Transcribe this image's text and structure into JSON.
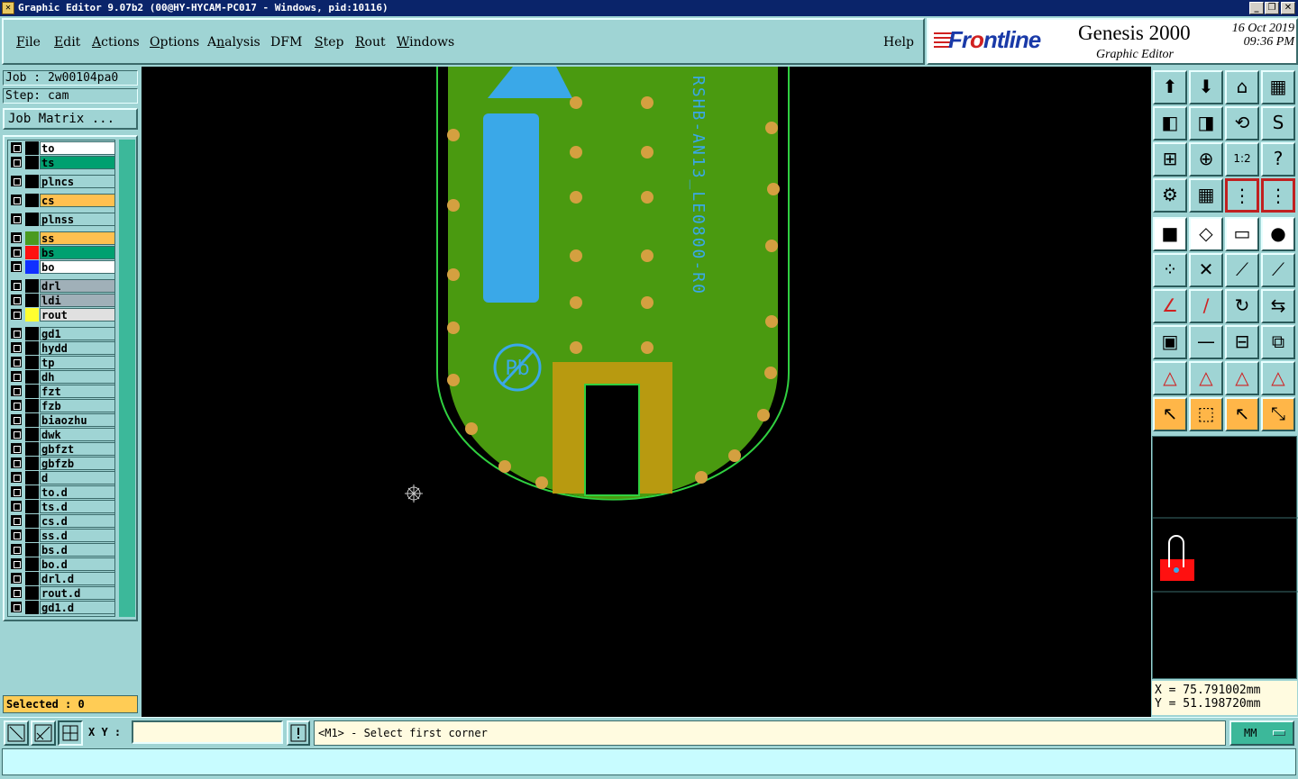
{
  "titlebar": {
    "title": "Graphic Editor 9.07b2  (00@HY-HYCAM-PC017 - Windows, pid:10116)",
    "app_icon": "x-icon"
  },
  "menu": {
    "items": [
      {
        "label": "File",
        "key": "F"
      },
      {
        "label": "Edit",
        "key": "E"
      },
      {
        "label": "Actions",
        "key": "A"
      },
      {
        "label": "Options",
        "key": "O"
      },
      {
        "label": "Analysis",
        "key": "n"
      },
      {
        "label": "DFM",
        "key": ""
      },
      {
        "label": "Step",
        "key": "S"
      },
      {
        "label": "Rout",
        "key": "R"
      },
      {
        "label": "Windows",
        "key": "W"
      }
    ],
    "help": "Help"
  },
  "brand": {
    "logo": "Frontline",
    "product": "Genesis 2000",
    "subtitle": "Graphic Editor",
    "date": "16 Oct 2019",
    "time": "09:36 PM"
  },
  "job": {
    "job_label": "Job : 2w00104pa0",
    "step_label": "Step: cam",
    "job_matrix": "Job Matrix ..."
  },
  "layers": [
    {
      "name": "to",
      "color": "#ffffff",
      "swatch": "#000000"
    },
    {
      "name": "ts",
      "color": "#00a070",
      "swatch": "#000000"
    },
    {
      "name": "plncs",
      "color": "#9fd4d4",
      "swatch": "#000000"
    },
    {
      "name": "cs",
      "color": "#ffc050",
      "swatch": "#000000"
    },
    {
      "name": "plnss",
      "color": "#9fd4d4",
      "swatch": "#000000"
    },
    {
      "name": "ss",
      "color": "#ffc050",
      "swatch": "#4a9a20"
    },
    {
      "name": "bs",
      "color": "#00a070",
      "swatch": "#ff1010"
    },
    {
      "name": "bo",
      "color": "#ffffff",
      "swatch": "#1030ff"
    },
    {
      "name": "drl",
      "color": "#a0b0b8",
      "swatch": "#000000"
    },
    {
      "name": "ldi",
      "color": "#a0b0b8",
      "swatch": "#000000"
    },
    {
      "name": "rout",
      "color": "#e0e0e0",
      "swatch": "#ffff30"
    },
    {
      "name": "gd1",
      "color": "#9fd4d4",
      "swatch": "#000000"
    },
    {
      "name": "hydd",
      "color": "#9fd4d4",
      "swatch": "#000000"
    },
    {
      "name": "tp",
      "color": "#9fd4d4",
      "swatch": "#000000"
    },
    {
      "name": "dh",
      "color": "#9fd4d4",
      "swatch": "#000000"
    },
    {
      "name": "fzt",
      "color": "#9fd4d4",
      "swatch": "#000000"
    },
    {
      "name": "fzb",
      "color": "#9fd4d4",
      "swatch": "#000000"
    },
    {
      "name": "biaozhu",
      "color": "#9fd4d4",
      "swatch": "#000000"
    },
    {
      "name": "dwk",
      "color": "#9fd4d4",
      "swatch": "#000000"
    },
    {
      "name": "gbfzt",
      "color": "#9fd4d4",
      "swatch": "#000000"
    },
    {
      "name": "gbfzb",
      "color": "#9fd4d4",
      "swatch": "#000000"
    },
    {
      "name": "d",
      "color": "#9fd4d4",
      "swatch": "#000000"
    },
    {
      "name": "to.d",
      "color": "#9fd4d4",
      "swatch": "#000000"
    },
    {
      "name": "ts.d",
      "color": "#9fd4d4",
      "swatch": "#000000"
    },
    {
      "name": "cs.d",
      "color": "#9fd4d4",
      "swatch": "#000000"
    },
    {
      "name": "ss.d",
      "color": "#9fd4d4",
      "swatch": "#000000"
    },
    {
      "name": "bs.d",
      "color": "#9fd4d4",
      "swatch": "#000000"
    },
    {
      "name": "bo.d",
      "color": "#9fd4d4",
      "swatch": "#000000"
    },
    {
      "name": "drl.d",
      "color": "#9fd4d4",
      "swatch": "#000000"
    },
    {
      "name": "rout.d",
      "color": "#9fd4d4",
      "swatch": "#000000"
    },
    {
      "name": "gd1.d",
      "color": "#9fd4d4",
      "swatch": "#000000"
    }
  ],
  "selected": "Selected : 0",
  "canvas": {
    "silkscreen_text": "RSHB-AN13_LE0800-R0",
    "colors": {
      "board": "#4a9a10",
      "pad": "#d4a040",
      "silk": "#3aa8e8",
      "outline": "#30d040",
      "gold": "#b89a10"
    }
  },
  "coords": {
    "x": "X = 75.791002mm",
    "y": "Y = 51.198720mm"
  },
  "bottom": {
    "xy_label": "X Y :",
    "xy_value": "",
    "prompt": "<M1> - Select first corner",
    "units": "MM"
  }
}
